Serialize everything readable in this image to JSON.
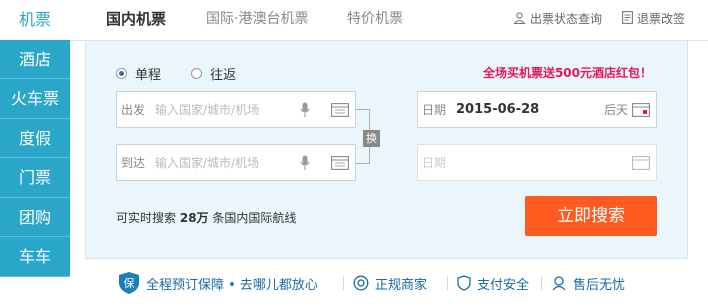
{
  "colors": {
    "nav_bg": "#2aa6c9",
    "panel_bg": "#eaf6fb",
    "promo": "#e6155a",
    "search_button": "#ff5a1f",
    "guarantee_text": "#1a6b9f"
  },
  "sidenav": {
    "items": [
      {
        "label": "机票"
      },
      {
        "label": "酒店"
      },
      {
        "label": "火车票"
      },
      {
        "label": "度假"
      },
      {
        "label": "门票"
      },
      {
        "label": "团购"
      },
      {
        "label": "车车"
      }
    ]
  },
  "tabs": [
    {
      "label": "国内机票"
    },
    {
      "label": "国际·港澳台机票"
    },
    {
      "label": "特价机票"
    }
  ],
  "toplinks": {
    "status": {
      "label": "出票状态查询",
      "icon": "user-icon"
    },
    "refund": {
      "label": "退票改签",
      "icon": "document-icon"
    }
  },
  "trip_type": {
    "oneway": "单程",
    "roundtrip": "往返"
  },
  "promo": "全场买机票送500元酒店红包！",
  "from": {
    "label": "出发",
    "placeholder": "输入国家/城市/机场"
  },
  "to": {
    "label": "到达",
    "placeholder": "输入国家/城市/机场"
  },
  "swap_label": "换",
  "depart_date": {
    "label": "日期",
    "value": "2015-06-28",
    "day": "后天"
  },
  "return_date": {
    "label": "日期"
  },
  "count": {
    "prefix": "可实时搜索",
    "number": "28万",
    "suffix": "条国内国际航线"
  },
  "search_button": "立即搜索",
  "guarantees": [
    {
      "label": "全程预订保障 • 去哪儿都放心",
      "icon": "shield-bao-icon"
    },
    {
      "label": "正规商家",
      "icon": "badge-icon"
    },
    {
      "label": "支付安全",
      "icon": "shield-icon"
    },
    {
      "label": "售后无忧",
      "icon": "support-icon"
    }
  ]
}
